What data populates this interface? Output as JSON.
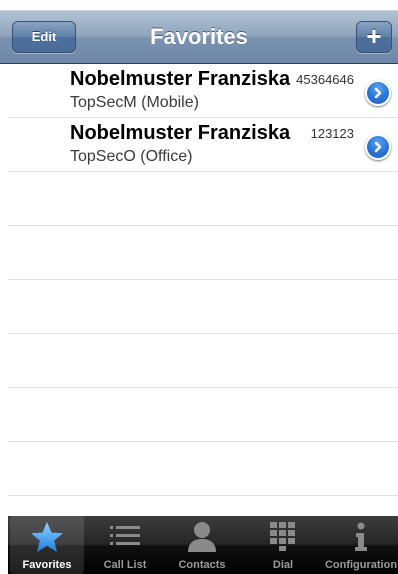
{
  "navbar": {
    "title": "Favorites",
    "edit_label": "Edit",
    "add_label": "+"
  },
  "favorites": [
    {
      "name": "Nobelmuster Franziska",
      "subtitle": "TopSecM (Mobile)",
      "number": "45364646"
    },
    {
      "name": "Nobelmuster Franziska",
      "subtitle": "TopSecO (Office)",
      "number": "123123"
    }
  ],
  "tabbar": {
    "tabs": [
      {
        "label": "Favorites",
        "icon": "star-icon",
        "active": true
      },
      {
        "label": "Call List",
        "icon": "list-icon",
        "active": false
      },
      {
        "label": "Contacts",
        "icon": "person-icon",
        "active": false
      },
      {
        "label": "Dial",
        "icon": "keypad-icon",
        "active": false
      },
      {
        "label": "Configuration",
        "icon": "info-icon",
        "active": false
      }
    ]
  },
  "colors": {
    "nav_bar": "#7b93b0",
    "accent": "#2a74d3",
    "tab_bar": "#1a1a1a"
  }
}
